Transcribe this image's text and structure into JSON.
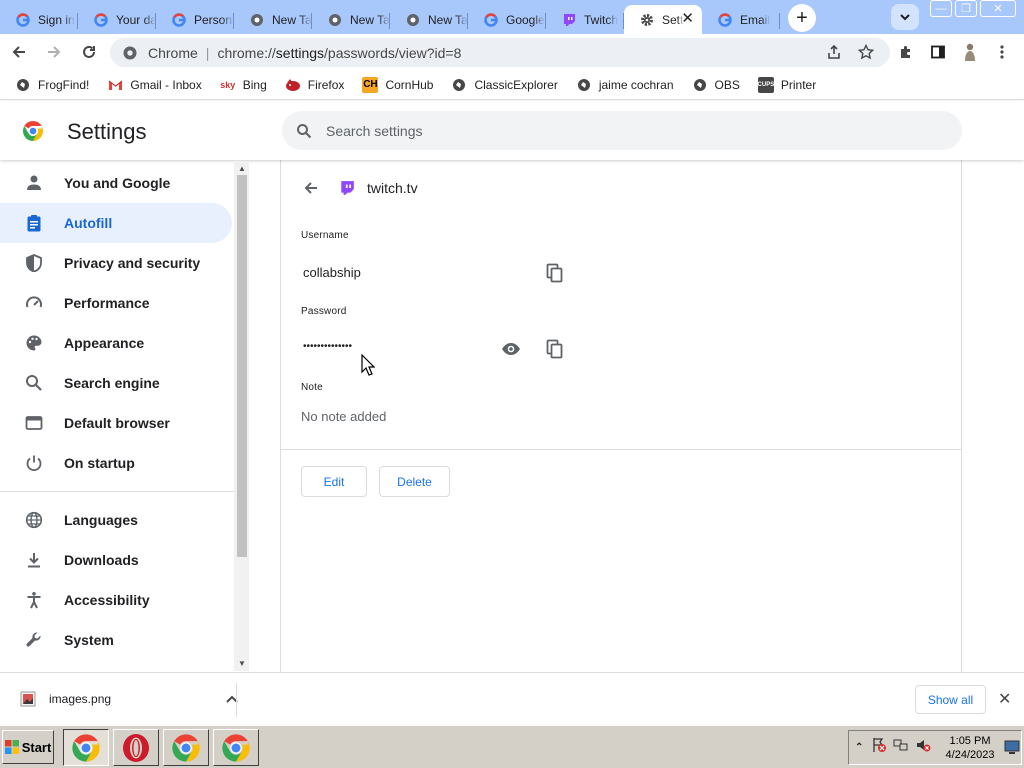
{
  "browser": {
    "tabs": [
      {
        "title": "Sign in",
        "icon": "google-icon"
      },
      {
        "title": "Your data",
        "icon": "google-icon"
      },
      {
        "title": "Personal",
        "icon": "google-icon"
      },
      {
        "title": "New Tab",
        "icon": "chrome-icon"
      },
      {
        "title": "New Tab",
        "icon": "chrome-icon"
      },
      {
        "title": "New Tab",
        "icon": "chrome-icon"
      },
      {
        "title": "Google",
        "icon": "google-icon"
      },
      {
        "title": "Twitch",
        "icon": "twitch-icon"
      },
      {
        "title": "Settings",
        "icon": "gear-icon",
        "active": true
      },
      {
        "title": "Email",
        "icon": "google-icon"
      }
    ],
    "omnibox": {
      "label": "Chrome",
      "url_prefix": "chrome://",
      "url_host": "settings",
      "url_path": "/passwords/view?id=8"
    },
    "bookmarks": [
      {
        "label": "FrogFind!",
        "icon": "globe-icon"
      },
      {
        "label": "Gmail - Inbox",
        "icon": "gmail-icon"
      },
      {
        "label": "Bing",
        "icon": "bing-icon"
      },
      {
        "label": "Firefox",
        "icon": "firefox-icon"
      },
      {
        "label": "CornHub",
        "icon": "ch-icon"
      },
      {
        "label": "ClassicExplorer",
        "icon": "globe-icon"
      },
      {
        "label": "jaime cochran",
        "icon": "globe-icon"
      },
      {
        "label": "OBS",
        "icon": "globe-icon"
      },
      {
        "label": "Printer",
        "icon": "cups-icon"
      }
    ]
  },
  "settings": {
    "title": "Settings",
    "search_placeholder": "Search settings",
    "nav": [
      {
        "label": "You and Google",
        "icon": "person-icon"
      },
      {
        "label": "Autofill",
        "icon": "clipboard-icon",
        "active": true
      },
      {
        "label": "Privacy and security",
        "icon": "shield-icon"
      },
      {
        "label": "Performance",
        "icon": "speedometer-icon"
      },
      {
        "label": "Appearance",
        "icon": "palette-icon"
      },
      {
        "label": "Search engine",
        "icon": "search-icon"
      },
      {
        "label": "Default browser",
        "icon": "browser-icon"
      },
      {
        "label": "On startup",
        "icon": "power-icon"
      },
      {
        "label": "Languages",
        "icon": "globe-icon"
      },
      {
        "label": "Downloads",
        "icon": "download-icon"
      },
      {
        "label": "Accessibility",
        "icon": "accessibility-icon"
      },
      {
        "label": "System",
        "icon": "wrench-icon"
      }
    ],
    "password_detail": {
      "site": "twitch.tv",
      "username_label": "Username",
      "username": "collabship",
      "password_label": "Password",
      "password_masked": "••••••••••••••",
      "note_label": "Note",
      "note": "No note added",
      "edit_label": "Edit",
      "delete_label": "Delete"
    }
  },
  "downloads_bar": {
    "file": "images.png",
    "show_all": "Show all"
  },
  "taskbar": {
    "start": "Start",
    "time": "1:05 PM",
    "date": "4/24/2023"
  },
  "colors": {
    "tabstrip": "#a8c7fa",
    "accent": "#1a73e8",
    "active_nav_bg": "#e8f0fe",
    "twitch": "#9146ff"
  }
}
